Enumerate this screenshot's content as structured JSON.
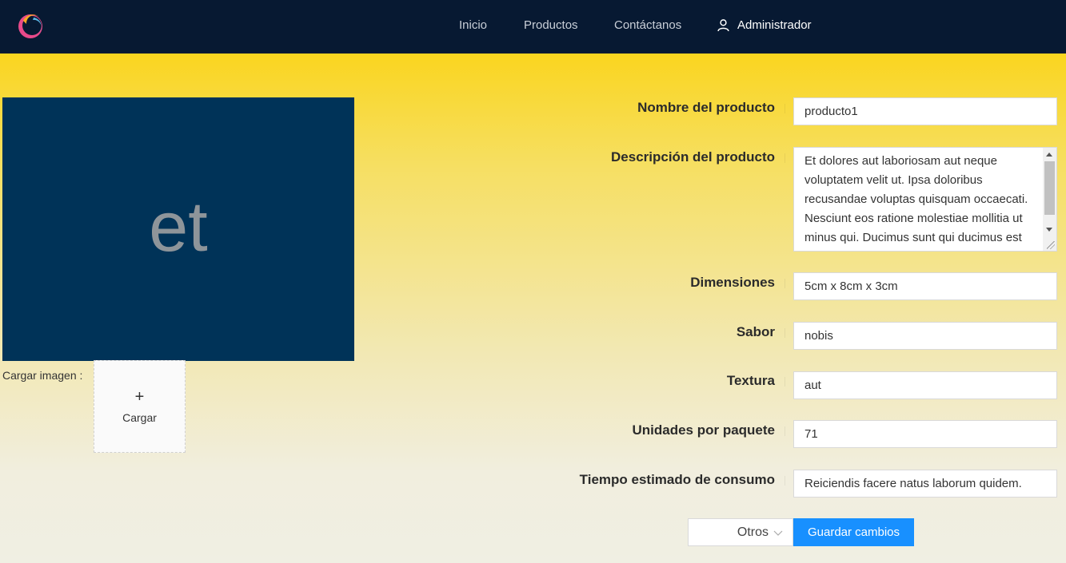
{
  "nav": {
    "items": [
      "Inicio",
      "Productos",
      "Contáctanos"
    ],
    "admin_label": "Administrador"
  },
  "preview": {
    "text": "et"
  },
  "upload": {
    "label": "Cargar imagen",
    "button_label": "Cargar"
  },
  "form": {
    "fields": [
      {
        "label": "Nombre del producto",
        "value": "producto1"
      },
      {
        "label": "Descripción del producto",
        "value": "Et dolores aut laboriosam aut neque voluptatem velit ut. Ipsa doloribus recusandae voluptas quisquam occaecati. Nesciunt eos ratione molestiae mollitia ut minus qui. Ducimus sunt qui ducimus est"
      },
      {
        "label": "Dimensiones",
        "value": "5cm x 8cm x 3cm"
      },
      {
        "label": "Sabor",
        "value": "nobis"
      },
      {
        "label": "Textura",
        "value": "aut"
      },
      {
        "label": "Unidades por paquete",
        "value": "71"
      },
      {
        "label": "Tiempo estimado de consumo",
        "value": "Reiciendis facere natus laborum quidem."
      }
    ],
    "category_select": "Otros",
    "save_label": "Guardar cambios"
  },
  "colors": {
    "navbar": "#071932",
    "preview_bg": "#003358",
    "primary": "#1890ff",
    "gradient_top": "#fad51f",
    "gradient_bottom": "#f0efe3"
  },
  "icons": [
    "app-logo-icon",
    "user-icon",
    "plus-icon",
    "chevron-down-icon"
  ]
}
